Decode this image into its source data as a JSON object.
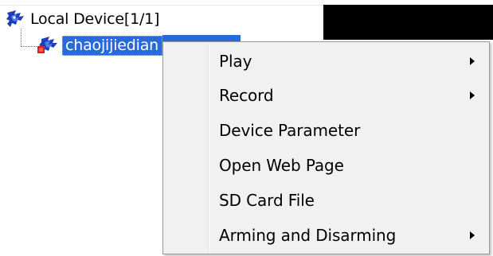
{
  "tree": {
    "root": {
      "label": "Local Device[1/1]",
      "icon": "device-group-icon"
    },
    "child": {
      "label": "chaojijiedian",
      "icon": "device-node-icon",
      "selected": true
    }
  },
  "context_menu": {
    "items": [
      {
        "label": "Play",
        "has_submenu": true
      },
      {
        "label": "Record",
        "has_submenu": true
      },
      {
        "label": "Device Parameter",
        "has_submenu": false
      },
      {
        "label": "Open Web Page",
        "has_submenu": false
      },
      {
        "label": "SD Card File",
        "has_submenu": false
      },
      {
        "label": "Arming and Disarming",
        "has_submenu": true
      }
    ]
  },
  "colors": {
    "selection": "#2a6ad8",
    "menu_background": "#f1f1f1",
    "video_panel": "#000000"
  }
}
